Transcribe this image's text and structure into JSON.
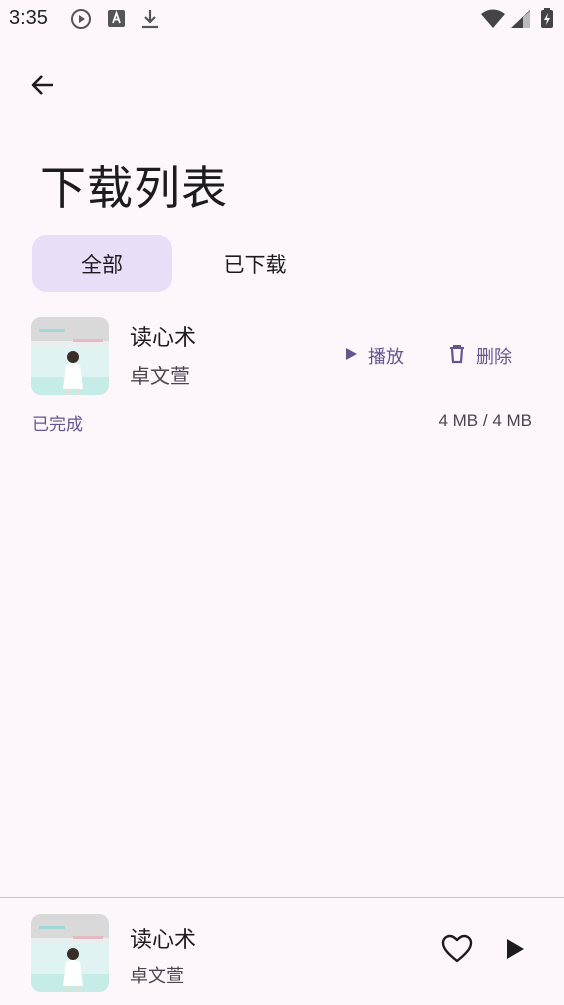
{
  "status_bar": {
    "time": "3:35",
    "left_icons": [
      "play-circle-icon",
      "a-box-icon",
      "download-icon"
    ],
    "right_icons": [
      "wifi-icon",
      "signal-icon",
      "battery-charging-icon"
    ]
  },
  "header": {
    "back_icon": "arrow-left-icon",
    "title": "下载列表"
  },
  "tabs": [
    {
      "label": "全部",
      "active": true
    },
    {
      "label": "已下载",
      "active": false
    }
  ],
  "downloads": [
    {
      "title": "读心术",
      "artist": "卓文萱",
      "play_label": "播放",
      "delete_label": "删除",
      "status": "已完成",
      "size": "4 MB / 4 MB"
    }
  ],
  "mini_player": {
    "title": "读心术",
    "artist": "卓文萱",
    "favorite_icon": "heart-outline-icon",
    "play_icon": "play-icon"
  },
  "colors": {
    "background": "#fdf7fc",
    "accent": "#65558f",
    "tab_active": "#e8def8",
    "text": "#1d1b20"
  }
}
